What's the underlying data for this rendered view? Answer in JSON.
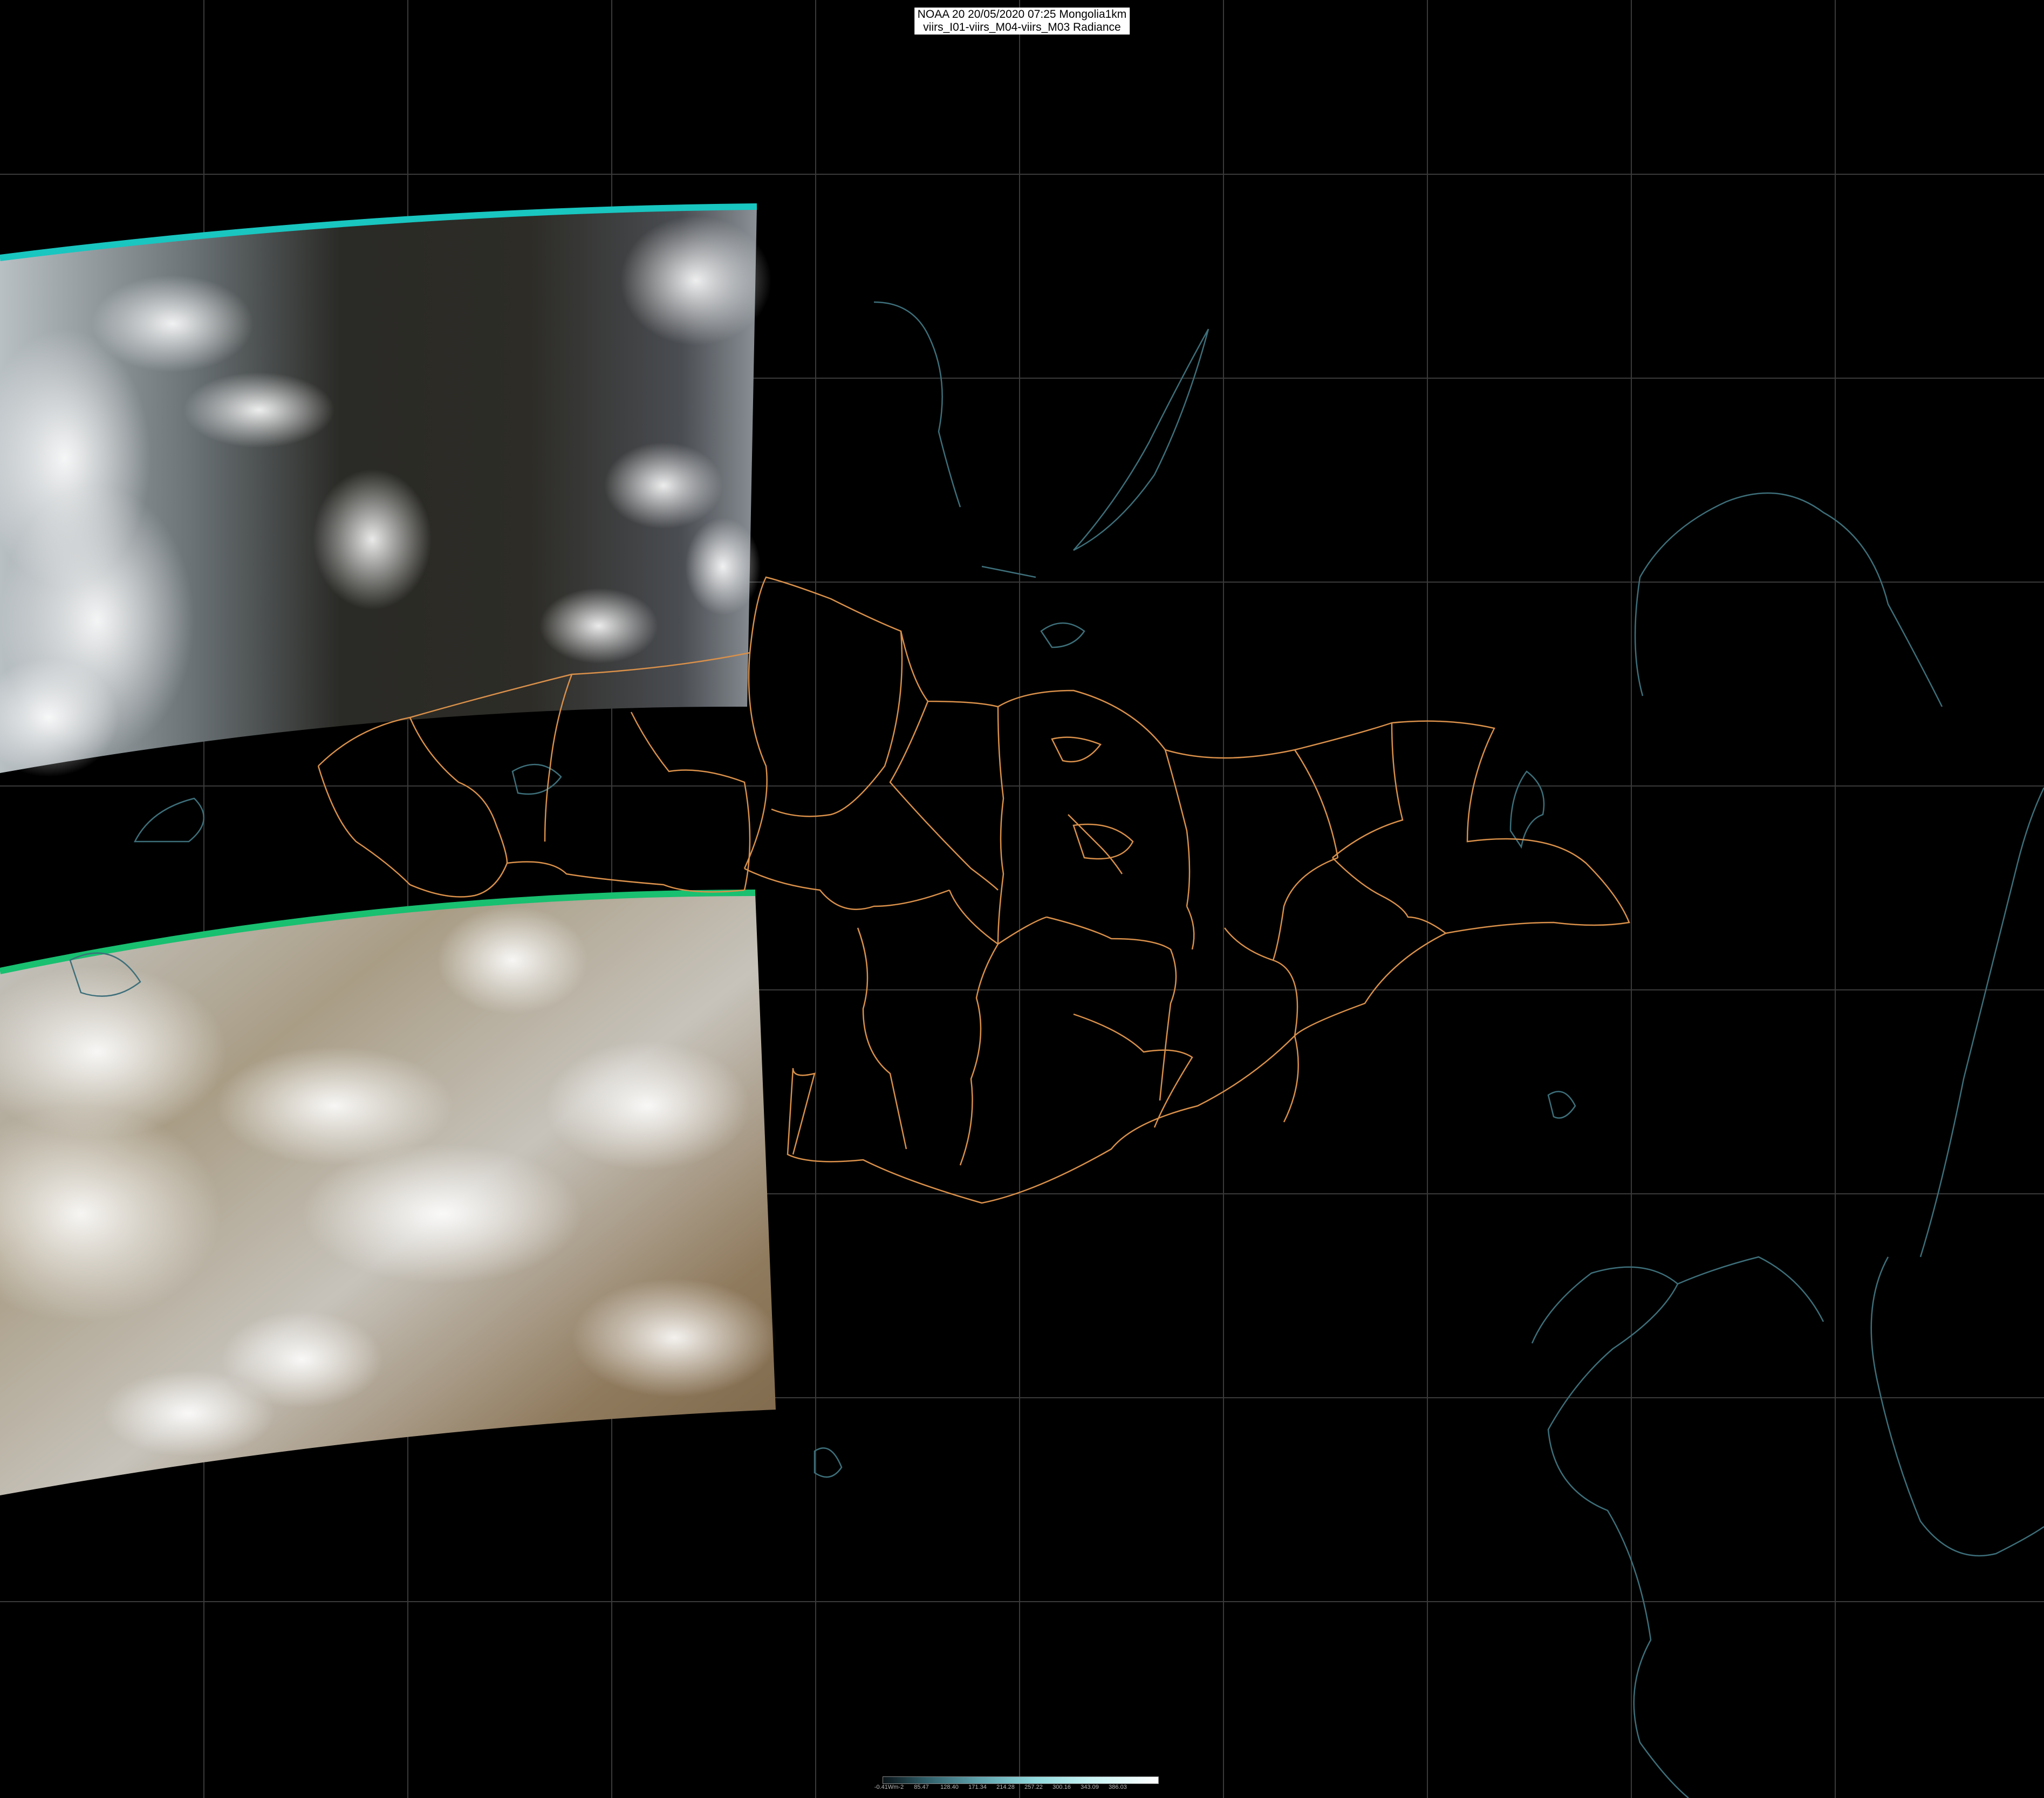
{
  "title": {
    "line1": "NOAA 20 20/05/2020 07:25 Mongolia1km",
    "line2": "viirs_I01-viirs_M04-viirs_M03 Radiance"
  },
  "colorbar": {
    "ticks": [
      "-0.41Wm-2",
      "85.47",
      "128.40",
      "171.34",
      "214.28",
      "257.22",
      "300.16",
      "343.09",
      "386.03"
    ],
    "gradient_colors": [
      "#0a1418",
      "#2e5c66",
      "#5fa3ad",
      "#8fd8dc",
      "#c6f2f3",
      "#ffffff"
    ]
  },
  "map": {
    "background_color": "#000000",
    "graticule_color": "#3a3a3a",
    "coastline_color": "#3d6f7a",
    "border_color": "#d9904a",
    "swath_edge_colors": [
      "#19c6c0",
      "#18c070"
    ],
    "swaths": [
      "north-swath-siberia",
      "south-swath-gobi-tibet"
    ]
  }
}
